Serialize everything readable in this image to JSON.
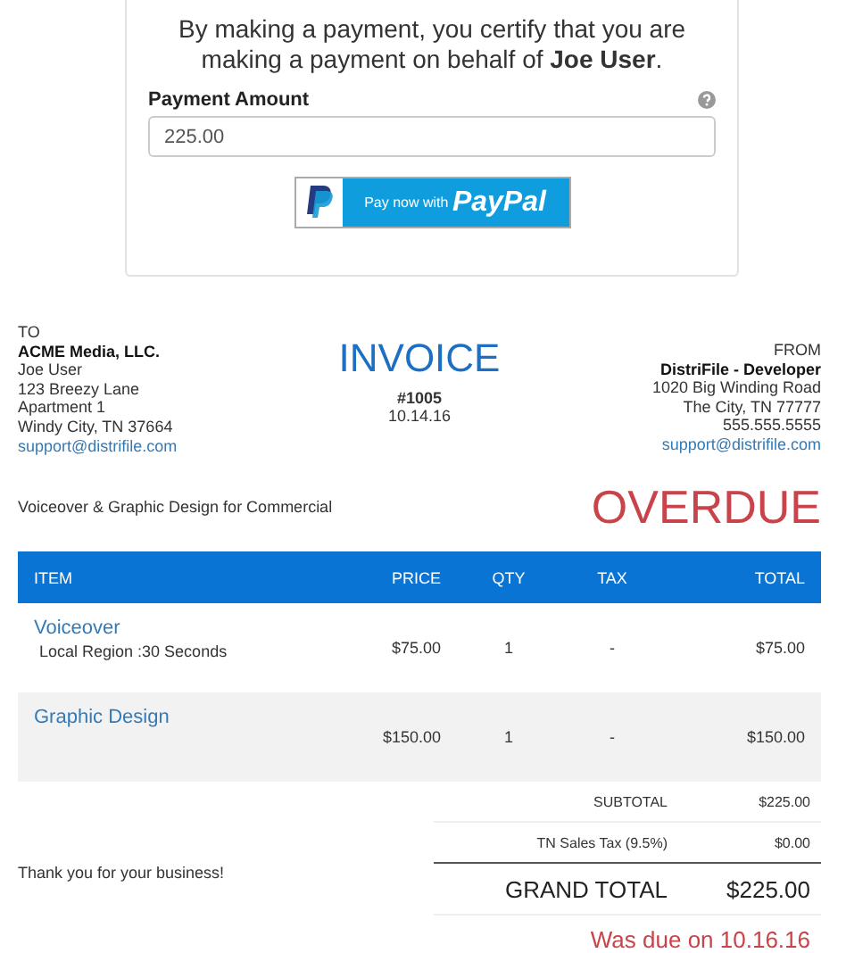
{
  "payment": {
    "notice": "By making a payment, you certify that you are making a payment on behalf of **Joe User**.",
    "amount_label": "Payment Amount",
    "amount_value": "225.00",
    "button": {
      "prefix": "Pay now with",
      "brand": "PayPal"
    }
  },
  "invoice": {
    "to": {
      "heading": "TO",
      "company": "ACME Media, LLC.",
      "lines": [
        "Joe User",
        "123 Breezy Lane",
        "Apartment 1",
        "Windy City, TN 37664"
      ],
      "email": "support@distrifile.com"
    },
    "title": "INVOICE",
    "number": "#1005",
    "date": "10.14.16",
    "from": {
      "heading": "FROM",
      "company": "DistriFile - Developer",
      "lines": [
        "1020 Big Winding Road",
        "The City, TN 77777",
        "555.555.5555"
      ],
      "email": "support@distrifile.com"
    },
    "description": "Voiceover & Graphic Design for Commercial",
    "status": "OVERDUE",
    "columns": [
      "ITEM",
      "PRICE",
      "QTY",
      "TAX",
      "TOTAL"
    ],
    "rows": [
      {
        "name": "Voiceover",
        "detail": "Local Region :30 Seconds",
        "price": "$75.00",
        "qty": "1",
        "tax": "-",
        "total": "$75.00"
      },
      {
        "name": "Graphic Design",
        "price": "$150.00",
        "qty": "1",
        "tax": "-",
        "total": "$150.00"
      }
    ],
    "thanks": "Thank you for your business!",
    "totals": [
      {
        "kind": "minor",
        "label": "SUBTOTAL",
        "value": "$225.00"
      },
      {
        "kind": "minor",
        "label": "TN Sales Tax (9.5%)",
        "value": "$0.00"
      },
      {
        "kind": "grand",
        "label": "GRAND TOTAL",
        "value": "$225.00"
      }
    ],
    "due": "Was due on 10.16.16"
  }
}
